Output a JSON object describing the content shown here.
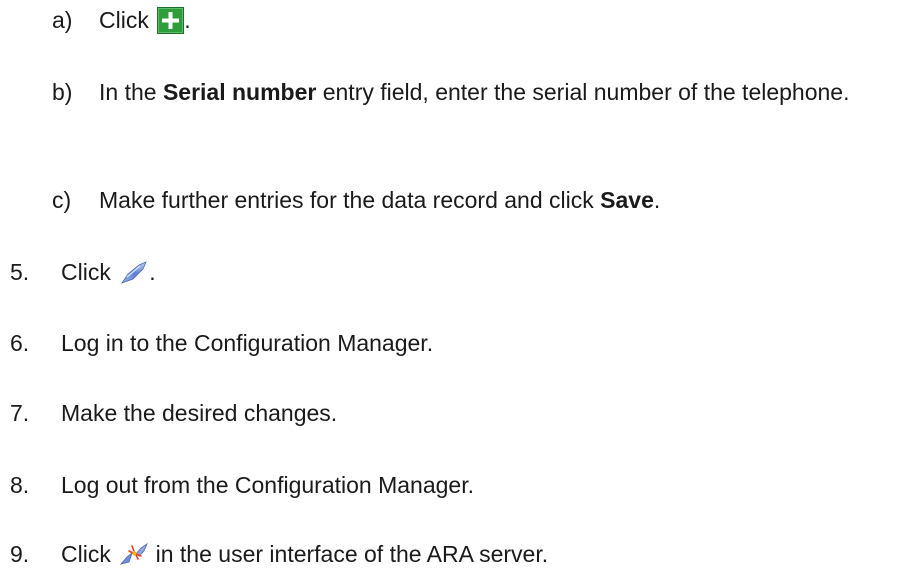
{
  "steps": [
    {
      "marker": "a)",
      "before": "Click ",
      "after": "."
    },
    {
      "marker": "b)",
      "before": "In the ",
      "bold": "Serial number",
      "after": " entry field, enter the serial number of the telephone."
    },
    {
      "marker": "c)",
      "before": "Make further entries for the data record and click ",
      "bold": "Save",
      "after": "."
    },
    {
      "marker": "5.",
      "before": "Click ",
      "after": "."
    },
    {
      "marker": "6.",
      "text": "Log in to the Configuration Manager."
    },
    {
      "marker": "7.",
      "text": "Make the desired changes."
    },
    {
      "marker": "8.",
      "text": "Log out from the Configuration Manager."
    },
    {
      "marker": "9.",
      "before": "Click ",
      "after": " in the user interface of the ARA server."
    }
  ],
  "icons": {
    "a": "add-icon",
    "step5": "connect-icon",
    "step9": "disconnect-icon"
  },
  "colors": {
    "add_icon_bg": "#2e9e3c",
    "add_icon_border": "#1f6f2a",
    "text": "#1a1a1a"
  }
}
